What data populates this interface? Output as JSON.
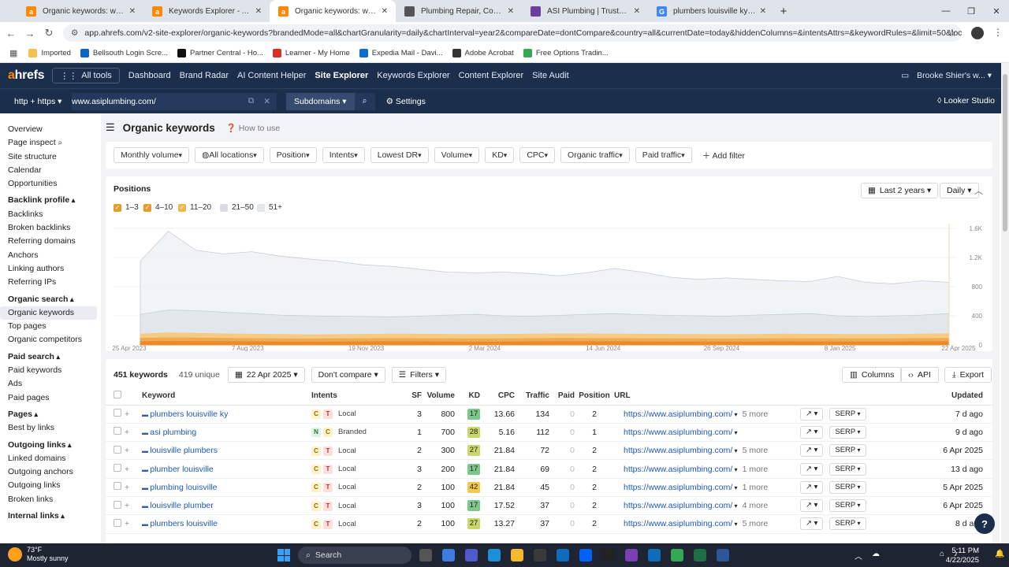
{
  "browser": {
    "tabs": [
      {
        "label": "Organic keywords: www.davisp",
        "icon_color": "#ff8800",
        "icon": "ahrefs-icon",
        "active": false
      },
      {
        "label": "Keywords Explorer - Ahrefs",
        "icon_color": "#ff8800",
        "icon": "ahrefs-icon",
        "active": false
      },
      {
        "label": "Organic keywords: www.asiplu",
        "icon_color": "#ff8800",
        "icon": "ahrefs-icon",
        "active": true
      },
      {
        "label": "Plumbing Repair, Commercial P",
        "icon_color": "#555555",
        "icon": "globe-icon",
        "active": false
      },
      {
        "label": "ASI Plumbing | Trusted Plumbe",
        "icon_color": "#6b3fa0",
        "icon": "site-icon",
        "active": false
      },
      {
        "label": "plumbers louisville ky - Google",
        "icon_color": "#4285f4",
        "icon": "google-icon",
        "active": false
      }
    ],
    "url": "app.ahrefs.com/v2-site-explorer/organic-keywords?brandedMode=all&chartGranularity=daily&chartInterval=year2&compareDate=dontCompare&country=all&currentDate=today&hiddenColumns=&intentsAttrs=&keywordRules=&limit=50&localMode=all&mai...",
    "bookmarks": [
      {
        "label": "Imported",
        "color": "#f2c14e"
      },
      {
        "label": "Bellsouth Login Scre...",
        "color": "#0a66c2"
      },
      {
        "label": "Partner Central - Ho...",
        "color": "#111111"
      },
      {
        "label": "Learner - My Home",
        "color": "#d93025"
      },
      {
        "label": "Expedia Mail - Davi...",
        "color": "#0a6ed1"
      },
      {
        "label": "Adobe Acrobat",
        "color": "#333333"
      },
      {
        "label": "Free Options Tradin...",
        "color": "#34a853"
      }
    ]
  },
  "ahrefs": {
    "logo_a": "a",
    "logo_rest": "hrefs",
    "all_tools": "All tools",
    "nav": [
      "Dashboard",
      "Brand Radar",
      "AI Content Helper",
      "Site Explorer",
      "Keywords Explorer",
      "Content Explorer",
      "Site Audit"
    ],
    "active_nav": "Site Explorer",
    "user": "Brooke Shier's w...",
    "protocol": "http + https",
    "domain": "www.asiplumbing.com/",
    "subdomains": "Subdomains",
    "settings": "Settings",
    "looker": "Looker Studio"
  },
  "sidebar": [
    {
      "type": "item",
      "label": "Overview"
    },
    {
      "type": "item",
      "label": "Page inspect"
    },
    {
      "type": "item",
      "label": "Site structure"
    },
    {
      "type": "item",
      "label": "Calendar"
    },
    {
      "type": "item",
      "label": "Opportunities"
    },
    {
      "type": "sec",
      "label": "Backlink profile"
    },
    {
      "type": "item",
      "label": "Backlinks"
    },
    {
      "type": "item",
      "label": "Broken backlinks"
    },
    {
      "type": "item",
      "label": "Referring domains"
    },
    {
      "type": "item",
      "label": "Anchors"
    },
    {
      "type": "item",
      "label": "Linking authors"
    },
    {
      "type": "item",
      "label": "Referring IPs"
    },
    {
      "type": "sec",
      "label": "Organic search"
    },
    {
      "type": "item",
      "label": "Organic keywords",
      "selected": true
    },
    {
      "type": "item",
      "label": "Top pages"
    },
    {
      "type": "item",
      "label": "Organic competitors"
    },
    {
      "type": "sec",
      "label": "Paid search"
    },
    {
      "type": "item",
      "label": "Paid keywords"
    },
    {
      "type": "item",
      "label": "Ads"
    },
    {
      "type": "item",
      "label": "Paid pages"
    },
    {
      "type": "sec",
      "label": "Pages"
    },
    {
      "type": "item",
      "label": "Best by links"
    },
    {
      "type": "sec",
      "label": "Outgoing links"
    },
    {
      "type": "item",
      "label": "Linked domains"
    },
    {
      "type": "item",
      "label": "Outgoing anchors"
    },
    {
      "type": "item",
      "label": "Outgoing links"
    },
    {
      "type": "item",
      "label": "Broken links"
    },
    {
      "type": "sec",
      "label": "Internal links"
    }
  ],
  "page": {
    "title": "Organic keywords",
    "how_to": "How to use",
    "filters": [
      "Monthly volume",
      "All locations",
      "Position",
      "Intents",
      "Lowest DR",
      "Volume",
      "KD",
      "CPC",
      "Organic traffic",
      "Paid traffic"
    ],
    "add_filter": "Add filter"
  },
  "positions": {
    "title": "Positions",
    "checks": [
      {
        "label": "1–3",
        "color": "#e89a2c",
        "checked": true
      },
      {
        "label": "4–10",
        "color": "#e89a2c",
        "checked": true
      },
      {
        "label": "11–20",
        "color": "#f0b848",
        "checked": true
      },
      {
        "label": "21–50",
        "color": "#d9dde3",
        "checked": false
      },
      {
        "label": "51+",
        "color": "#e3e6ea",
        "checked": false
      }
    ],
    "range": "Last 2 years",
    "granularity": "Daily"
  },
  "chart_data": {
    "type": "area",
    "title": "Positions",
    "x_ticks": [
      "25 Apr 2023",
      "7 Aug 2023",
      "19 Nov 2023",
      "2 Mar 2024",
      "14 Jun 2024",
      "26 Sep 2024",
      "8 Jan 2025",
      "22 Apr 2025"
    ],
    "y_ticks": [
      "0",
      "400",
      "800",
      "1.2K",
      "1.6K"
    ],
    "ylim": [
      0,
      1600
    ],
    "series": [
      {
        "name": "1–3",
        "color": "#e8872a",
        "values": [
          45,
          50,
          48,
          46,
          44,
          42,
          40,
          41,
          43,
          45,
          44,
          42,
          40,
          42,
          44,
          46,
          45,
          44,
          43,
          42,
          41,
          40,
          42,
          44,
          43,
          42,
          41,
          42,
          44,
          45
        ]
      },
      {
        "name": "4–10",
        "color": "#f2a54a",
        "values": [
          90,
          98,
          95,
          90,
          88,
          85,
          82,
          84,
          86,
          88,
          87,
          85,
          83,
          85,
          88,
          90,
          89,
          88,
          86,
          85,
          84,
          82,
          84,
          87,
          86,
          85,
          84,
          85,
          88,
          90
        ]
      },
      {
        "name": "11–20",
        "color": "#f7c878",
        "values": [
          150,
          165,
          160,
          152,
          148,
          145,
          140,
          142,
          146,
          150,
          148,
          146,
          144,
          146,
          150,
          154,
          152,
          150,
          148,
          146,
          144,
          142,
          145,
          150,
          148,
          146,
          145,
          146,
          150,
          155
        ]
      },
      {
        "name": "21–50",
        "color": "#dfe4ea",
        "values": [
          420,
          480,
          470,
          450,
          430,
          410,
          400,
          395,
          390,
          385,
          395,
          410,
          420,
          400,
          395,
          405,
          420,
          430,
          415,
          405,
          400,
          395,
          410,
          420,
          430,
          400,
          390,
          400,
          410,
          430
        ]
      },
      {
        "name": "51+",
        "color": "#edf1f4",
        "values": [
          1150,
          1560,
          1300,
          1250,
          1280,
          1220,
          1180,
          1150,
          1100,
          1080,
          1040,
          1000,
          990,
          1000,
          980,
          950,
          990,
          1050,
          1000,
          930,
          900,
          920,
          900,
          880,
          870,
          940,
          860,
          840,
          880,
          860
        ]
      }
    ]
  },
  "keywords": {
    "count": "451 keywords",
    "unique": "419 unique",
    "date": "22 Apr 2025",
    "compare": "Don't compare",
    "filters": "Filters",
    "columns": "Columns",
    "api": "API",
    "export": "Export",
    "headers": [
      "Keyword",
      "Intents",
      "SF",
      "Volume",
      "KD",
      "CPC",
      "Traffic",
      "Paid",
      "Position",
      "URL",
      "Updated"
    ],
    "rows": [
      {
        "kw": "plumbers louisville ky",
        "i1": "C",
        "i2": "T",
        "il": "Local",
        "sf": "3",
        "vol": "800",
        "kd": "17",
        "kdc": "#7cc88a",
        "cpc": "13.66",
        "tr": "134",
        "paid": "0",
        "pos": "2",
        "url": "https://www.asiplumbing.com/",
        "more": "5 more",
        "upd": "7 d ago"
      },
      {
        "kw": "asi plumbing",
        "i1": "N",
        "i2": "C",
        "il": "Branded",
        "sf": "1",
        "vol": "700",
        "kd": "28",
        "kdc": "#c9d86a",
        "cpc": "5.16",
        "tr": "112",
        "paid": "0",
        "pos": "1",
        "url": "https://www.asiplumbing.com/",
        "more": "",
        "upd": "9 d ago"
      },
      {
        "kw": "louisville plumbers",
        "i1": "C",
        "i2": "T",
        "il": "Local",
        "sf": "2",
        "vol": "300",
        "kd": "27",
        "kdc": "#c9d86a",
        "cpc": "21.84",
        "tr": "72",
        "paid": "0",
        "pos": "2",
        "url": "https://www.asiplumbing.com/",
        "more": "5 more",
        "upd": "6 Apr 2025"
      },
      {
        "kw": "plumber louisville",
        "i1": "C",
        "i2": "T",
        "il": "Local",
        "sf": "3",
        "vol": "200",
        "kd": "17",
        "kdc": "#7cc88a",
        "cpc": "21.84",
        "tr": "69",
        "paid": "0",
        "pos": "2",
        "url": "https://www.asiplumbing.com/",
        "more": "1 more",
        "upd": "13 d ago"
      },
      {
        "kw": "plumbing louisville",
        "i1": "C",
        "i2": "T",
        "il": "Local",
        "sf": "2",
        "vol": "100",
        "kd": "42",
        "kdc": "#f2c94c",
        "cpc": "21.84",
        "tr": "45",
        "paid": "0",
        "pos": "2",
        "url": "https://www.asiplumbing.com/",
        "more": "1 more",
        "upd": "5 Apr 2025"
      },
      {
        "kw": "louisville plumber",
        "i1": "C",
        "i2": "T",
        "il": "Local",
        "sf": "3",
        "vol": "100",
        "kd": "17",
        "kdc": "#7cc88a",
        "cpc": "17.52",
        "tr": "37",
        "paid": "0",
        "pos": "2",
        "url": "https://www.asiplumbing.com/",
        "more": "4 more",
        "upd": "6 Apr 2025"
      },
      {
        "kw": "plumbers louisville",
        "i1": "C",
        "i2": "T",
        "il": "Local",
        "sf": "2",
        "vol": "100",
        "kd": "27",
        "kdc": "#c9d86a",
        "cpc": "13.27",
        "tr": "37",
        "paid": "0",
        "pos": "2",
        "url": "https://www.asiplumbing.com/",
        "more": "5 more",
        "upd": "8 d ago"
      }
    ],
    "serp": "SERP"
  },
  "taskbar": {
    "temp": "73°F",
    "weather": "Mostly sunny",
    "search": "Search",
    "time": "5:11 PM",
    "date": "4/22/2025"
  }
}
